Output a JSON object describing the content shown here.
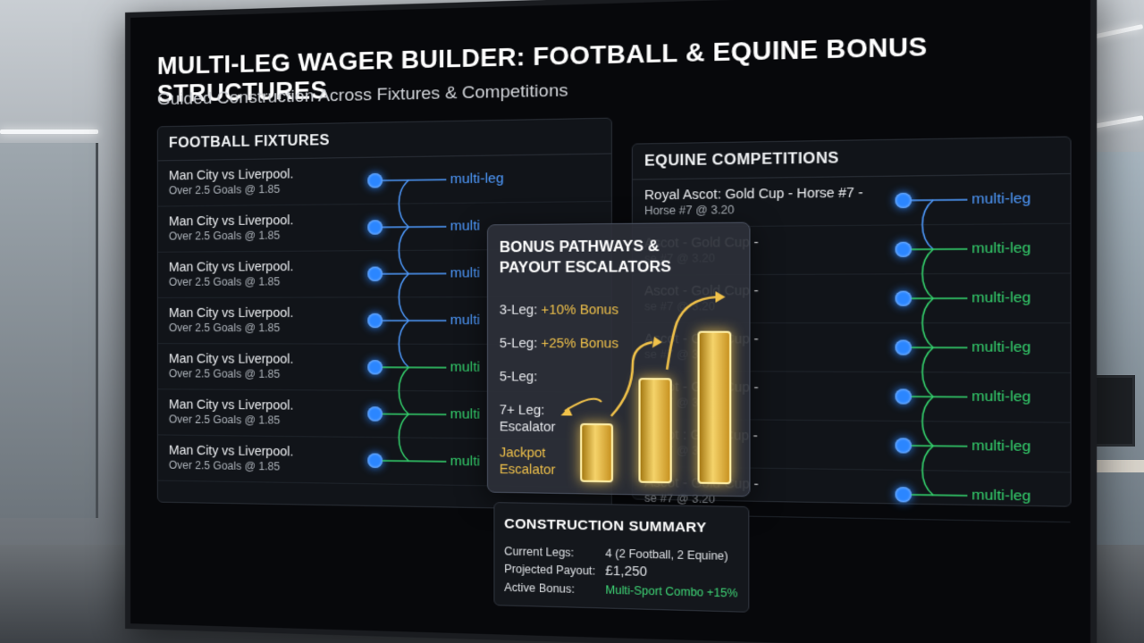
{
  "header": {
    "title": "MULTI-LEG WAGER BUILDER: FOOTBALL & EQUINE BONUS STRUCTURES",
    "subtitle": "Guided Construction Across Fixtures & Competitions"
  },
  "football": {
    "heading": "FOOTBALL FIXTURES",
    "rows": [
      {
        "match": "Man City vs Liverpool.",
        "market": "Over 2.5 Goals @ 1.85",
        "link": "multi-leg",
        "link_state": "blue"
      },
      {
        "match": "Man City vs Liverpool.",
        "market": "Over 2.5 Goals @ 1.85",
        "link": "multi",
        "link_state": "blue"
      },
      {
        "match": "Man City vs Liverpool.",
        "market": "Over 2.5 Goals @ 1.85",
        "link": "multi",
        "link_state": "blue"
      },
      {
        "match": "Man City vs Liverpool.",
        "market": "Over 2.5 Goals @ 1.85",
        "link": "multi",
        "link_state": "blue"
      },
      {
        "match": "Man City vs Liverpool.",
        "market": "Over 2.5 Goals @ 1.85",
        "link": "multi",
        "link_state": "green"
      },
      {
        "match": "Man City vs Liverpool.",
        "market": "Over 2.5 Goals @ 1.85",
        "link": "multi",
        "link_state": "green"
      },
      {
        "match": "Man City vs Liverpool.",
        "market": "Over 2.5 Goals @ 1.85",
        "link": "multi",
        "link_state": "green"
      }
    ]
  },
  "equine": {
    "heading": "EQUINE COMPETITIONS",
    "rows": [
      {
        "race": "Royal Ascot: Gold Cup - Horse #7 -",
        "odds": "Horse #7 @ 3.20",
        "link": "multi-leg",
        "link_state": "blue"
      },
      {
        "race": "Ascot - Gold Cup -",
        "odds": "se #7 @ 3.20",
        "link": "multi-leg",
        "link_state": "green"
      },
      {
        "race": "Ascot - Gold Cup -",
        "odds": "se #7 @ 3.20",
        "link": "multi-leg",
        "link_state": "green"
      },
      {
        "race": "Ascot - Gold Cup -",
        "odds": "se #7 @ 3.30",
        "link": "multi-leg",
        "link_state": "green"
      },
      {
        "race": "Ascot - Gold Cup -",
        "odds": "se #7 @ 3.30",
        "link": "multi-leg",
        "link_state": "green"
      },
      {
        "race": "Ascot : Gold Cup -",
        "odds": "se #7 @ 3.50",
        "link": "multi-leg",
        "link_state": "green"
      },
      {
        "race": "Ascot - Gold Cup -",
        "odds": "se #7 @ 3.20",
        "link": "multi-leg",
        "link_state": "green"
      }
    ]
  },
  "bonus": {
    "heading": "BONUS PATHWAYS & PAYOUT ESCALATORS",
    "tiers": [
      {
        "label": "3-Leg:",
        "bonus": "+10% Bonus"
      },
      {
        "label": "5-Leg:",
        "bonus": "+25% Bonus"
      },
      {
        "label": "5-Leg:",
        "bonus": ""
      },
      {
        "label": "7+ Leg: Escalator",
        "bonus": ""
      },
      {
        "label": "",
        "bonus": "Jackpot Escalator"
      }
    ],
    "bar_levels": [
      0.35,
      0.62,
      0.9
    ]
  },
  "summary": {
    "heading": "CONSTRUCTION SUMMARY",
    "current_legs_label": "Current Legs:",
    "current_legs_value": "4 (2 Football, 2 Equine)",
    "payout_label": "Projected Payout:",
    "payout_value": "£1,250",
    "bonus_label": "Active Bonus:",
    "bonus_value": "Multi-Sport Combo +15%"
  },
  "colors": {
    "link_blue": "#4f9bff",
    "link_green": "#35d46e",
    "gold": "#f1c24a",
    "background": "#07080b"
  }
}
